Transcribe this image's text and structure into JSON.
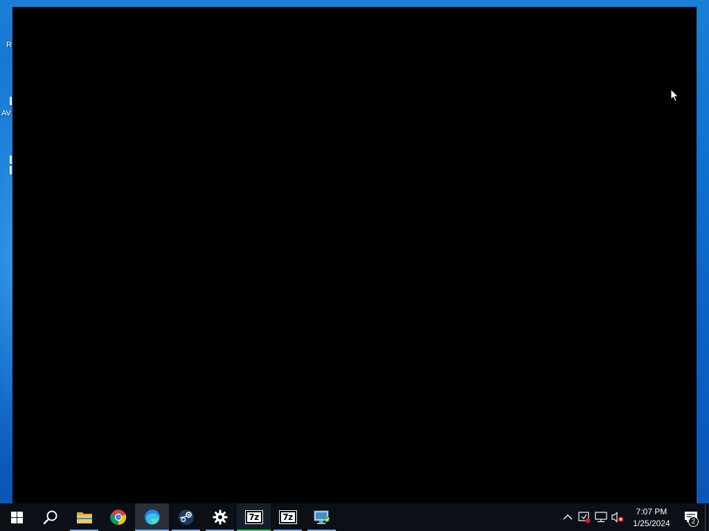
{
  "desktop": {
    "icon_label_fragments": [
      "R",
      "AV"
    ],
    "background_color": "#0f6fd0"
  },
  "app_window": {
    "background_color": "#000000"
  },
  "taskbar": {
    "background_color": "#0b0f16",
    "apps": [
      {
        "name": "start",
        "icon": "windows-logo-icon"
      },
      {
        "name": "search",
        "icon": "search-icon"
      },
      {
        "name": "file-explorer",
        "icon": "folder-icon"
      },
      {
        "name": "chrome",
        "icon": "chrome-icon"
      },
      {
        "name": "edge",
        "icon": "edge-icon",
        "active": true
      },
      {
        "name": "steam",
        "icon": "steam-icon"
      },
      {
        "name": "settings",
        "icon": "gear-icon"
      },
      {
        "name": "7zip-1",
        "icon": "7zip-icon",
        "label": "7z",
        "running": true
      },
      {
        "name": "7zip-2",
        "icon": "7zip-icon",
        "label": "7z"
      },
      {
        "name": "remote-desktop",
        "icon": "monitor-icon"
      }
    ],
    "tray": {
      "icons": [
        "chevron-up-icon",
        "security-icon",
        "network-icon",
        "volume-muted-icon"
      ],
      "time": "7:07 PM",
      "date": "1/25/2024",
      "notification_count": "2"
    }
  },
  "colors": {
    "accent_underline": "#7db1e8",
    "running_underline": "#2ecf6a",
    "error_red": "#e81123"
  }
}
